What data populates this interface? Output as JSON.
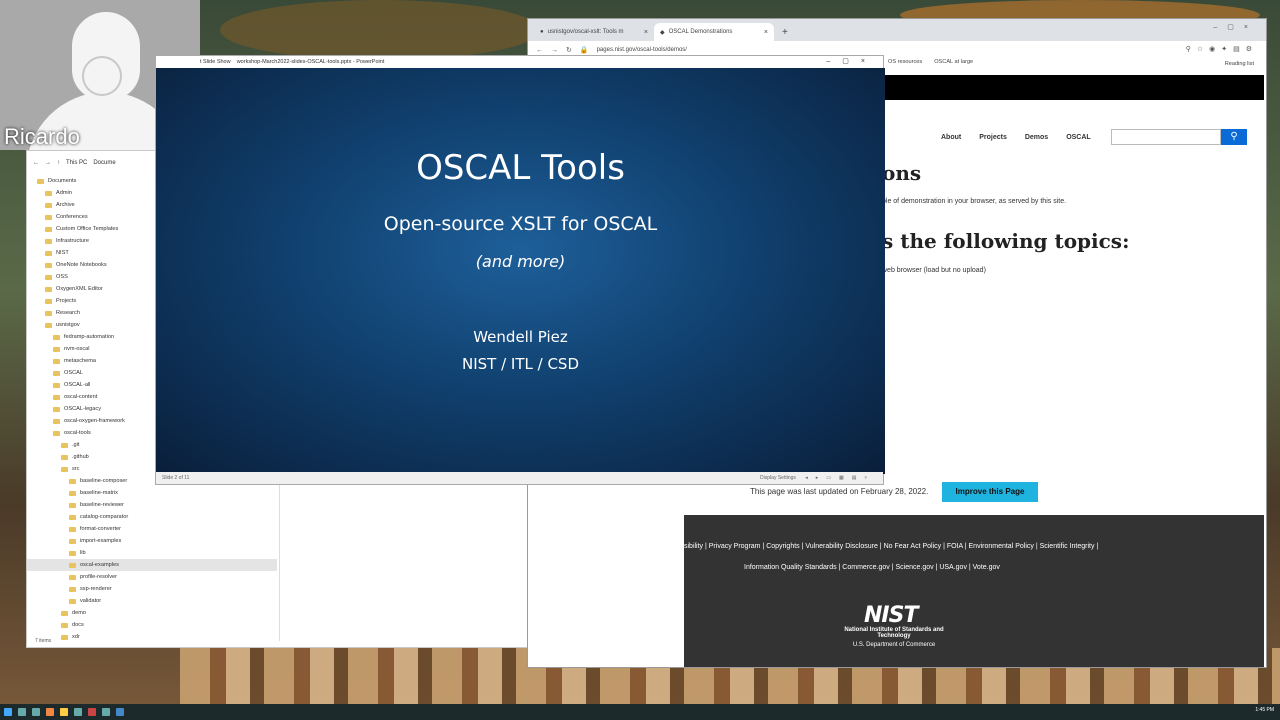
{
  "webcam": {
    "participant_name": "Ricardo"
  },
  "explorer": {
    "breadcrumb": [
      "This PC",
      "Docume"
    ],
    "tree": [
      "Documents",
      "Admin",
      "Archive",
      "Conferences",
      "Custom Office Templates",
      "Infrastructure",
      "NIST",
      "OneNote Notebooks",
      "OSS",
      "OxygenXML Editor",
      "Projects",
      "Research",
      "usnistgov",
      "fedramp-automation",
      "nvm-oscal",
      "metaschema",
      "OSCAL",
      "OSCAL-all",
      "oscal-content",
      "OSCAL-legacy",
      "oscal-oxygen-framework",
      "oscal-tools",
      ".git",
      ".github",
      "src",
      "baseline-composer",
      "baseline-matrix",
      "baseline-reviewer",
      "catalog-comparator",
      "format-converter",
      "import-examples",
      "lib",
      "oscal-examples",
      "profile-resolver",
      "ssp-renderer",
      "validator",
      "demo",
      "docs",
      "xdr"
    ],
    "selected_item": "oscal-examples",
    "status": "7 items"
  },
  "browser": {
    "tabs": [
      {
        "label": "usnistgov/oscal-xslt: Tools m"
      },
      {
        "label": "OSCAL Demonstrations"
      }
    ],
    "url": "pages.nist.gov/oscal-tools/demos/",
    "bookmarks": [
      "OS resources",
      "OSCAL at large"
    ],
    "reading_list": "Reading list",
    "nav": [
      "About",
      "Projects",
      "Demos",
      "OSCAL"
    ],
    "search_placeholder": "",
    "heading1": "ons",
    "para1": "ple of demonstration in your browser, as served by this site.",
    "heading2": "s the following topics:",
    "para2": "web browser (load but no upload)",
    "updated": "This page was last updated on February 28, 2022.",
    "improve_button": "Improve this Page",
    "footer_links_row1": "sibility  |  Privacy Program  |  Copyrights  |  Vulnerability Disclosure  |  No Fear Act Policy  |  FOIA  |  Environmental Policy  |  Scientific Integrity  |",
    "footer_links_row2": "Information Quality Standards  |  Commerce.gov  |  Science.gov  |  USA.gov  |  Vote.gov",
    "nist_logo": "NIST",
    "nist_name": "National Institute of Standards and Technology",
    "nist_dept": "U.S. Department of Commerce"
  },
  "powerpoint": {
    "window_title": "workshop-March2022-slides-OSCAL-tools.pptx - PowerPoint",
    "titlebar_prefix": "t Slide Show",
    "slide_title": "OSCAL Tools",
    "slide_subtitle": "Open-source XSLT for OSCAL",
    "slide_more": "(and more)",
    "author": "Wendell Piez",
    "affiliation": "NIST / ITL / CSD",
    "status_slide": "Slide 2 of 11",
    "display_settings": "Display Settings"
  },
  "taskbar": {
    "clock": "1:45 PM"
  },
  "colors": {
    "improve_button": "#1fb3e0",
    "search_button": "#0a6ad6",
    "footer_bg": "#333333",
    "slide_bg": "#10406e"
  }
}
